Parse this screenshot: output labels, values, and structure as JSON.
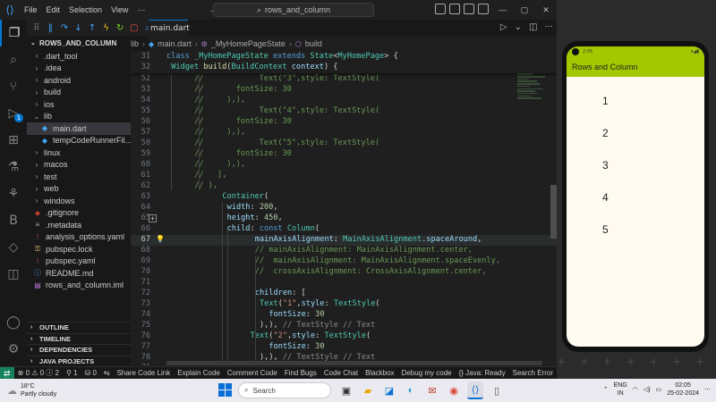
{
  "titlebar": {
    "menu": [
      "File",
      "Edit",
      "Selection",
      "View",
      "···"
    ],
    "search_text": "rows_and_column",
    "win_controls": [
      "—",
      "▢",
      "✕"
    ]
  },
  "activity_badge": "1",
  "sidebar": {
    "root": "ROWS_AND_COLUMN",
    "items": [
      {
        "label": ".dart_tool",
        "type": "folder",
        "depth": 1
      },
      {
        "label": ".idea",
        "type": "folder",
        "depth": 1
      },
      {
        "label": "android",
        "type": "folder",
        "depth": 1
      },
      {
        "label": "build",
        "type": "folder",
        "depth": 1
      },
      {
        "label": "ios",
        "type": "folder",
        "depth": 1
      },
      {
        "label": "lib",
        "type": "folder-open",
        "depth": 1
      },
      {
        "label": "main.dart",
        "type": "dart",
        "depth": 2,
        "selected": true
      },
      {
        "label": "tempCodeRunnerFil...",
        "type": "dart",
        "depth": 2
      },
      {
        "label": "linux",
        "type": "folder",
        "depth": 1
      },
      {
        "label": "macos",
        "type": "folder",
        "depth": 1
      },
      {
        "label": "test",
        "type": "folder",
        "depth": 1
      },
      {
        "label": "web",
        "type": "folder",
        "depth": 1
      },
      {
        "label": "windows",
        "type": "folder",
        "depth": 1
      },
      {
        "label": ".gitignore",
        "type": "git",
        "depth": 1
      },
      {
        "label": ".metadata",
        "type": "meta",
        "depth": 1
      },
      {
        "label": "analysis_options.yaml",
        "type": "yaml",
        "depth": 1
      },
      {
        "label": "pubspec.lock",
        "type": "lock",
        "depth": 1
      },
      {
        "label": "pubspec.yaml",
        "type": "yaml",
        "depth": 1
      },
      {
        "label": "README.md",
        "type": "info",
        "depth": 1
      },
      {
        "label": "rows_and_column.iml",
        "type": "iml",
        "depth": 1
      }
    ],
    "sections": [
      "OUTLINE",
      "TIMELINE",
      "DEPENDENCIES",
      "JAVA PROJECTS"
    ]
  },
  "tab": {
    "label": "main.dart"
  },
  "breadcrumb": [
    "lib",
    "main.dart",
    "_MyHomePageState",
    "build"
  ],
  "editor": {
    "sticky": [
      {
        "n": "31",
        "indent": 0,
        "parts": [
          [
            "kw",
            "class "
          ],
          [
            "cls",
            "_MyHomePageState "
          ],
          [
            "kw",
            "extends "
          ],
          [
            "cls",
            "State"
          ],
          [
            "txt",
            "<"
          ],
          [
            "cls",
            "MyHomePage"
          ],
          [
            "txt",
            "> {"
          ]
        ]
      },
      {
        "n": "32",
        "indent": 1,
        "parts": [
          [
            "cls",
            "Widget "
          ],
          [
            "fn",
            "build"
          ],
          [
            "txt",
            "("
          ],
          [
            "cls",
            "BuildContext "
          ],
          [
            "prop",
            "context"
          ],
          [
            "txt",
            ") {"
          ]
        ]
      }
    ],
    "lines": [
      {
        "n": "52",
        "indent": 6,
        "parts": [
          [
            "com",
            "//            Text(\"3\",style: TextStyle("
          ]
        ]
      },
      {
        "n": "53",
        "indent": 6,
        "parts": [
          [
            "com",
            "//       fontSize: 30"
          ]
        ]
      },
      {
        "n": "54",
        "indent": 6,
        "parts": [
          [
            "com",
            "//     ),),"
          ]
        ]
      },
      {
        "n": "55",
        "indent": 6,
        "parts": [
          [
            "com",
            "//            Text(\"4\",style: TextStyle("
          ]
        ]
      },
      {
        "n": "56",
        "indent": 6,
        "parts": [
          [
            "com",
            "//       fontSize: 30"
          ]
        ]
      },
      {
        "n": "57",
        "indent": 6,
        "parts": [
          [
            "com",
            "//     ),),"
          ]
        ]
      },
      {
        "n": "58",
        "indent": 6,
        "parts": [
          [
            "com",
            "//            Text(\"5\",style: TextStyle("
          ]
        ]
      },
      {
        "n": "59",
        "indent": 6,
        "parts": [
          [
            "com",
            "//       fontSize: 30"
          ]
        ]
      },
      {
        "n": "60",
        "indent": 6,
        "parts": [
          [
            "com",
            "//     ),),"
          ]
        ]
      },
      {
        "n": "61",
        "indent": 6,
        "parts": [
          [
            "com",
            "//   ],"
          ]
        ]
      },
      {
        "n": "62",
        "indent": 6,
        "parts": [
          [
            "com",
            "// ),"
          ]
        ]
      },
      {
        "n": "63",
        "indent": 12,
        "parts": [
          [
            "cls",
            "Container"
          ],
          [
            "txt",
            "("
          ]
        ]
      },
      {
        "n": "64",
        "indent": 13,
        "parts": [
          [
            "prop",
            "width"
          ],
          [
            "txt",
            ": "
          ],
          [
            "num",
            "200"
          ],
          [
            "txt",
            ","
          ]
        ]
      },
      {
        "n": "65",
        "indent": 13,
        "parts": [
          [
            "prop",
            "height"
          ],
          [
            "txt",
            ": "
          ],
          [
            "num",
            "450"
          ],
          [
            "txt",
            ","
          ]
        ],
        "plus": true
      },
      {
        "n": "66",
        "indent": 13,
        "parts": [
          [
            "prop",
            "child"
          ],
          [
            "txt",
            ": "
          ],
          [
            "kw",
            "const "
          ],
          [
            "cls",
            "Column"
          ],
          [
            "txt",
            "("
          ]
        ]
      },
      {
        "n": "67",
        "indent": 19,
        "parts": [
          [
            "prop",
            "mainAxisAlignment"
          ],
          [
            "txt",
            ": "
          ],
          [
            "cls",
            "MainAxisAlignment"
          ],
          [
            "txt",
            "."
          ],
          [
            "prop",
            "spaceAround"
          ],
          [
            "txt",
            ","
          ]
        ],
        "current": true,
        "bulb": true
      },
      {
        "n": "68",
        "indent": 19,
        "parts": [
          [
            "com",
            "// mainAxisAlignment: MainAxisAlignment.center,"
          ]
        ]
      },
      {
        "n": "69",
        "indent": 19,
        "parts": [
          [
            "com",
            "//  mainAxisAlignment: MainAxisAlignment.spaceEvenly,"
          ]
        ]
      },
      {
        "n": "70",
        "indent": 19,
        "parts": [
          [
            "com",
            "//  crossAxisAlignment: CrossAxisAlignment.center,"
          ]
        ]
      },
      {
        "n": "71",
        "indent": 0,
        "parts": []
      },
      {
        "n": "72",
        "indent": 19,
        "parts": [
          [
            "prop",
            "children"
          ],
          [
            "txt",
            ": ["
          ]
        ]
      },
      {
        "n": "73",
        "indent": 20,
        "parts": [
          [
            "cls",
            "Text"
          ],
          [
            "txt",
            "("
          ],
          [
            "str",
            "\"1\""
          ],
          [
            "txt",
            ","
          ],
          [
            "prop",
            "style"
          ],
          [
            "txt",
            ": "
          ],
          [
            "cls",
            "TextStyle"
          ],
          [
            "txt",
            "("
          ]
        ]
      },
      {
        "n": "74",
        "indent": 22,
        "parts": [
          [
            "prop",
            "fontSize"
          ],
          [
            "txt",
            ": "
          ],
          [
            "num",
            "30"
          ]
        ]
      },
      {
        "n": "75",
        "indent": 20,
        "parts": [
          [
            "txt",
            "),), "
          ],
          [
            "hint",
            "// TextStyle // Text"
          ]
        ]
      },
      {
        "n": "76",
        "indent": 18,
        "parts": [
          [
            "cls",
            "Text"
          ],
          [
            "txt",
            "("
          ],
          [
            "str",
            "\"2\""
          ],
          [
            "txt",
            ","
          ],
          [
            "prop",
            "style"
          ],
          [
            "txt",
            ": "
          ],
          [
            "cls",
            "TextStyle"
          ],
          [
            "txt",
            "("
          ]
        ]
      },
      {
        "n": "77",
        "indent": 22,
        "parts": [
          [
            "prop",
            "fontSize"
          ],
          [
            "txt",
            ": "
          ],
          [
            "num",
            "30"
          ]
        ]
      },
      {
        "n": "78",
        "indent": 20,
        "parts": [
          [
            "txt",
            "),), "
          ],
          [
            "hint",
            "// TextStyle // Text"
          ]
        ]
      },
      {
        "n": "79",
        "indent": 18,
        "parts": [
          [
            "cls",
            "Text"
          ],
          [
            "txt",
            "("
          ],
          [
            "str",
            "\"3\""
          ],
          [
            "txt",
            ","
          ],
          [
            "prop",
            "style"
          ],
          [
            "txt",
            ": "
          ],
          [
            "cls",
            "TextStyle"
          ],
          [
            "txt",
            "("
          ]
        ]
      }
    ]
  },
  "statusbar": {
    "remote_icon": "remote-icon",
    "items": [
      "⊗ 0 ⚠ 0 ⓘ 2",
      "⚲ 1",
      "⛁ 0",
      "⇆",
      "Share Code Link",
      "Explain Code",
      "Comment Code",
      "Find Bugs",
      "Code Chat",
      "Blackbox",
      "Debug my code",
      "{} Java: Ready",
      "Search Error"
    ]
  },
  "phone": {
    "status_time": "2:05",
    "app_title": "Rows and Column",
    "numbers": [
      "1",
      "2",
      "3",
      "4",
      "5"
    ],
    "colors": {
      "appbar": "#a4c800",
      "body": "#fffbf1"
    }
  },
  "taskbar": {
    "weather_temp": "18°C",
    "weather_desc": "Partly cloudy",
    "search_placeholder": "Search",
    "lang_top": "ENG",
    "lang_bottom": "IN",
    "time": "02:05",
    "date": "25-02-2024"
  }
}
